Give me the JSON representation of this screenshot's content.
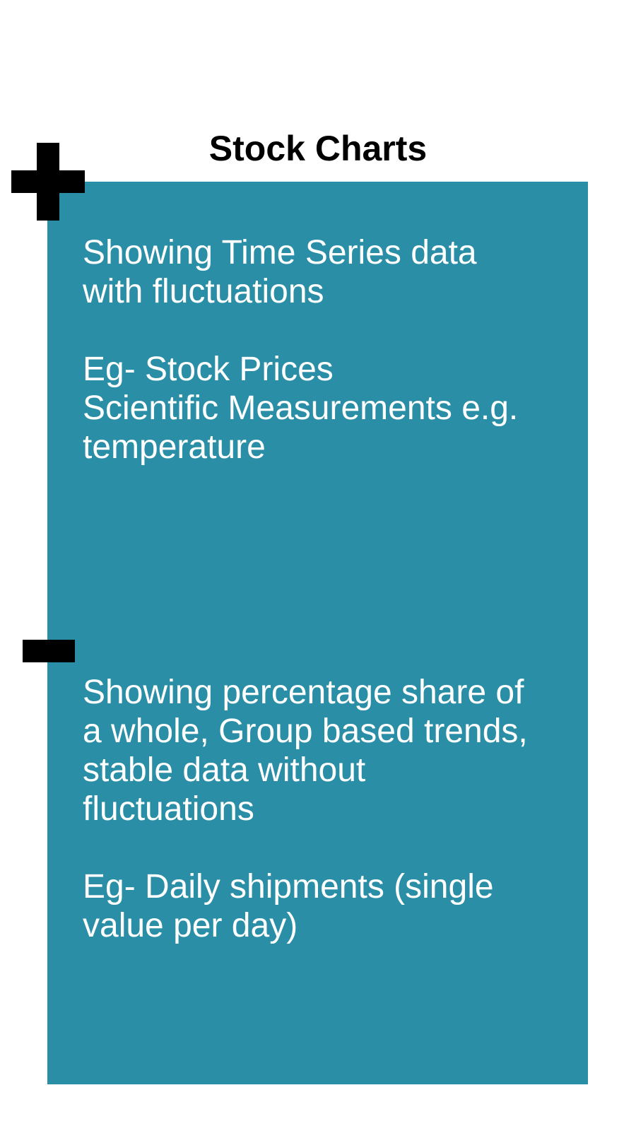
{
  "title": "Stock Charts",
  "colors": {
    "panel": "#2a8fa6",
    "marker": "#000000",
    "text": "#ffffff"
  },
  "pros": {
    "icon": "plus-icon",
    "lines": [
      "Showing Time Series data",
      "with fluctuations"
    ],
    "examples": [
      "Eg- Stock Prices",
      "Scientific Measurements e.g.",
      "temperature"
    ]
  },
  "cons": {
    "icon": "minus-icon",
    "lines": [
      "Showing percentage share of",
      "a whole, Group based trends,",
      "stable data without",
      "fluctuations"
    ],
    "examples": [
      "Eg- Daily shipments (single",
      "value per day)"
    ]
  }
}
